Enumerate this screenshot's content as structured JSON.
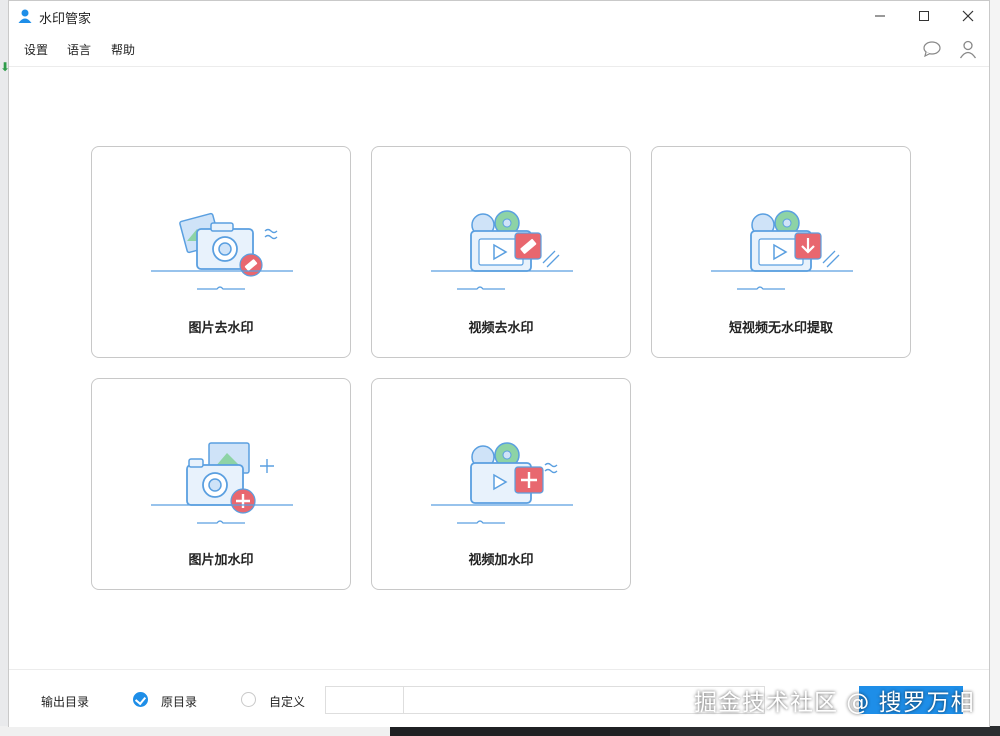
{
  "window": {
    "title": "水印管家",
    "minimize_icon": "minimize-icon",
    "maximize_icon": "maximize-icon",
    "close_icon": "close-icon"
  },
  "menu": {
    "items": [
      {
        "label": "设置"
      },
      {
        "label": "语言"
      },
      {
        "label": "帮助"
      }
    ],
    "right_icons": [
      "chat-bubble-icon",
      "user-icon"
    ]
  },
  "cards": [
    {
      "label": "图片去水印",
      "icon": "photo-remove-watermark-icon"
    },
    {
      "label": "视频去水印",
      "icon": "video-remove-watermark-icon"
    },
    {
      "label": "短视频无水印提取",
      "icon": "short-video-extract-icon"
    },
    {
      "label": "图片加水印",
      "icon": "photo-add-watermark-icon"
    },
    {
      "label": "视频加水印",
      "icon": "video-add-watermark-icon"
    }
  ],
  "footer": {
    "output_label": "输出目录",
    "options": [
      {
        "label": "原目录",
        "selected": true
      },
      {
        "label": "自定义",
        "selected": false
      }
    ],
    "path_value": ""
  },
  "overlay_watermark": "掘金技术社区 @ 搜罗万相",
  "colors": {
    "accent": "#1e8ee8",
    "icon_blue": "#5a9fe0",
    "icon_light_blue": "#cfe3f8",
    "icon_red": "#e8676f",
    "icon_green": "#8dd3a6"
  }
}
